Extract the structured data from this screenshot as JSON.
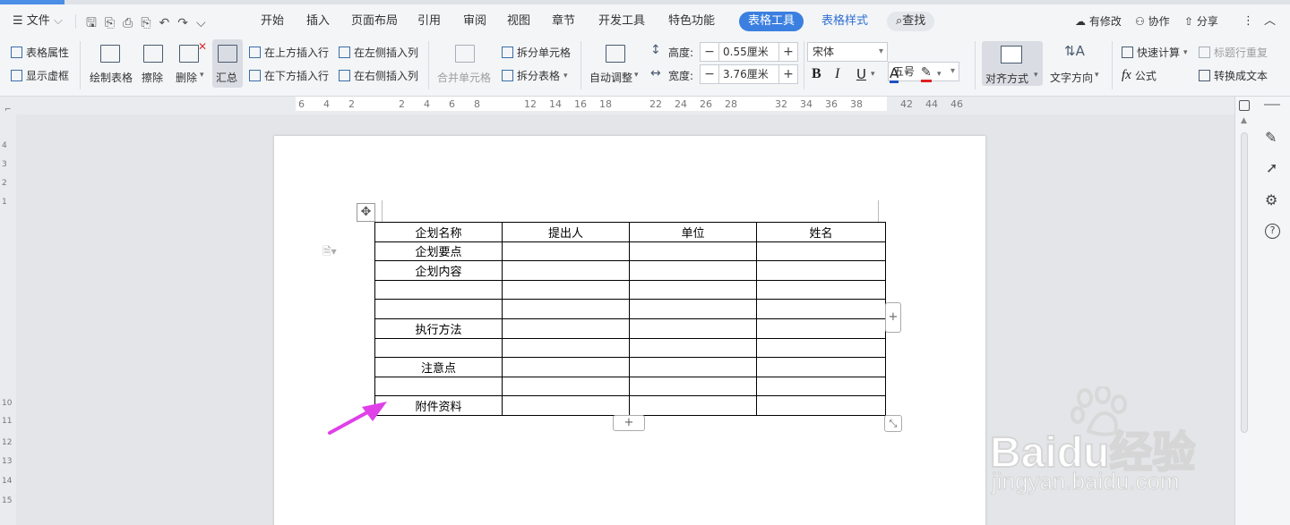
{
  "menu": {
    "file_label": "文件",
    "tabs": [
      "开始",
      "插入",
      "页面布局",
      "引用",
      "审阅",
      "视图",
      "章节",
      "开发工具",
      "特色功能"
    ],
    "active_tab": "表格工具",
    "style_tab": "表格样式",
    "search_label": "查找",
    "right": {
      "modified": "有修改",
      "collab": "协作",
      "share": "分享"
    }
  },
  "ribbon": {
    "table_props": "表格属性",
    "show_grid": "显示虚框",
    "draw_table": "绘制表格",
    "erase": "擦除",
    "delete": "删除",
    "summary": "汇总",
    "insert_above": "在上方插入行",
    "insert_below": "在下方插入行",
    "insert_left": "在左侧插入列",
    "insert_right": "在右侧插入列",
    "merge_cells": "合并单元格",
    "split_cells": "拆分单元格",
    "split_table": "拆分表格",
    "auto_adjust": "自动调整",
    "height_label": "高度:",
    "height_value": "0.55厘米",
    "width_label": "宽度:",
    "width_value": "3.76厘米",
    "font_name": "宋体",
    "font_size": "五号",
    "align": "对齐方式",
    "text_dir": "文字方向",
    "quick_calc": "快速计算",
    "formula": "公式",
    "repeat_header": "标题行重复",
    "to_text": "转换成文本",
    "bold": "B",
    "italic": "I",
    "underline": "U",
    "font_color": "A",
    "fx": "fx"
  },
  "ruler_top": [
    "6",
    "4",
    "2",
    "2",
    "4",
    "6",
    "8",
    "12",
    "14",
    "16",
    "18",
    "22",
    "24",
    "26",
    "28",
    "32",
    "34",
    "36",
    "38",
    "42",
    "44",
    "46"
  ],
  "ruler_left": [
    "4",
    "3",
    "2",
    "1",
    "10",
    "11",
    "12",
    "13",
    "14",
    "15"
  ],
  "table": {
    "rows": [
      [
        "企划名称",
        "提出人",
        "单位",
        "姓名"
      ],
      [
        "企划要点",
        "",
        "",
        ""
      ],
      [
        "企划内容",
        "",
        "",
        ""
      ],
      [
        "",
        "",
        "",
        ""
      ],
      [
        "",
        "",
        "",
        ""
      ],
      [
        "执行方法",
        "",
        "",
        ""
      ],
      [
        "",
        "",
        "",
        ""
      ],
      [
        "注意点",
        "",
        "",
        ""
      ],
      [
        "",
        "",
        "",
        ""
      ],
      [
        "附件资料",
        "",
        "",
        ""
      ]
    ]
  },
  "watermark": {
    "brand": "Baidu经验",
    "url": "jingyan.baidu.com"
  },
  "colors": {
    "accent": "#3b7fe0",
    "arrow": "#e040e8"
  }
}
